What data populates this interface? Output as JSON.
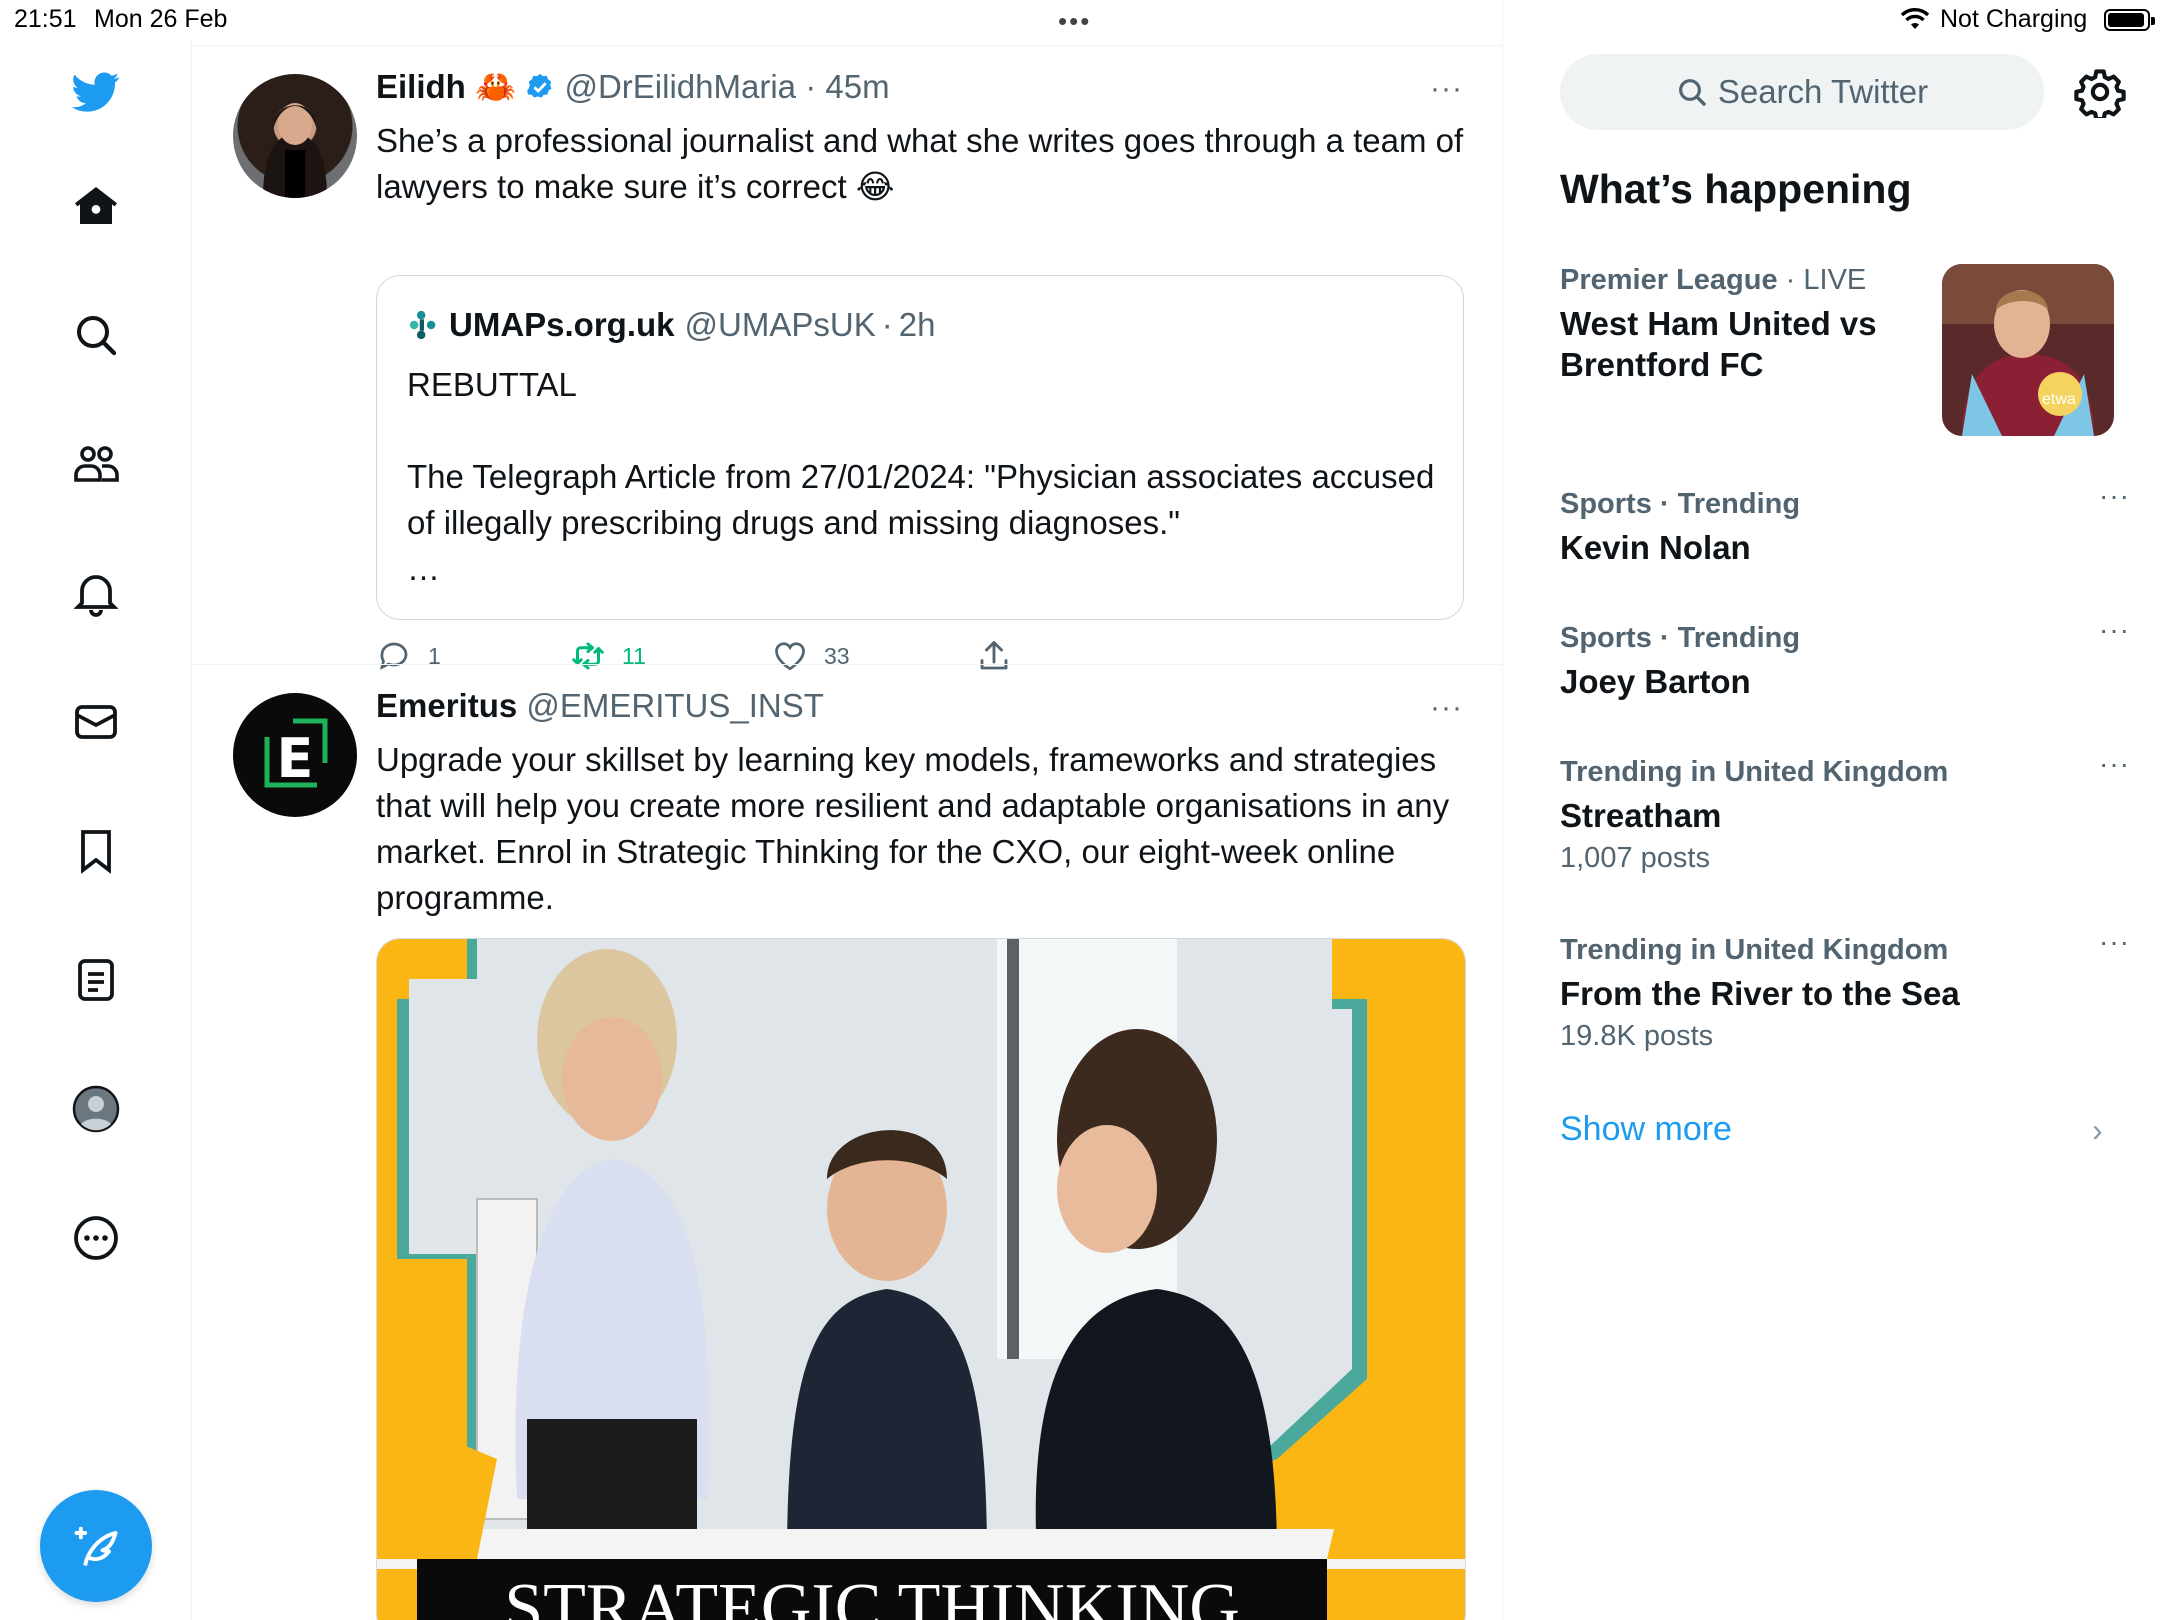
{
  "status_bar": {
    "time": "21:51",
    "date": "Mon 26 Feb",
    "charging": "Not Charging"
  },
  "colors": {
    "accent": "#1d9bf0",
    "retweet_green": "#00ba7c",
    "muted_text": "#536471",
    "border": "#cfd9de"
  },
  "nav": {
    "items": [
      "twitter-logo",
      "home-icon",
      "explore-icon",
      "communities-icon",
      "notifications-icon",
      "messages-icon",
      "bookmarks-icon",
      "lists-icon",
      "profile-icon",
      "more-icon"
    ],
    "compose": "compose-icon"
  },
  "timeline": {
    "tweets": [
      {
        "name": "Eilidh",
        "emoji": "🦀",
        "verified": true,
        "handle": "@DrEilidhMaria",
        "sep": "·",
        "time": "45m",
        "more": "···",
        "text": "She’s a professional journalist and what she writes goes through a team of lawyers to make sure it’s correct 😂",
        "quote": {
          "name": "UMAPs.org.uk",
          "handle": "@UMAPsUK",
          "sep": "·",
          "time": "2h",
          "body": "REBUTTAL\n\nThe Telegraph Article from 27/01/2024: \"Physician associates accused of illegally prescribing drugs and missing diagnoses.\"\n…"
        },
        "actions": {
          "replies": "1",
          "retweets": "11",
          "likes": "33"
        }
      },
      {
        "name": "Emeritus",
        "handle": "@EMERITUS_INST",
        "more": "···",
        "avatar_letter": "E",
        "text": "Upgrade your skillset by learning key models, frameworks and strategies that will help you create more resilient and adaptable organisations in any market. Enrol in Strategic Thinking for the CXO, our eight-week online programme.",
        "media_caption": "STRATEGIC THINKING"
      }
    ]
  },
  "sidebar": {
    "search_placeholder": "Search Twitter",
    "heading": "What’s happening",
    "trends": [
      {
        "category": "Premier League",
        "sep": "·",
        "status": "LIVE",
        "title": "West Ham United vs Brentford FC",
        "has_image": true
      },
      {
        "category": "Sports · Trending",
        "title": "Kevin Nolan",
        "more": "···"
      },
      {
        "category": "Sports · Trending",
        "title": "Joey Barton",
        "more": "···"
      },
      {
        "category": "Trending in United Kingdom",
        "title": "Streatham",
        "count": "1,007 posts",
        "more": "···"
      },
      {
        "category": "Trending in United Kingdom",
        "title": "From the River to the Sea",
        "count": "19.8K posts",
        "more": "···"
      }
    ],
    "show_more": "Show more",
    "show_more_chevron": "›"
  }
}
